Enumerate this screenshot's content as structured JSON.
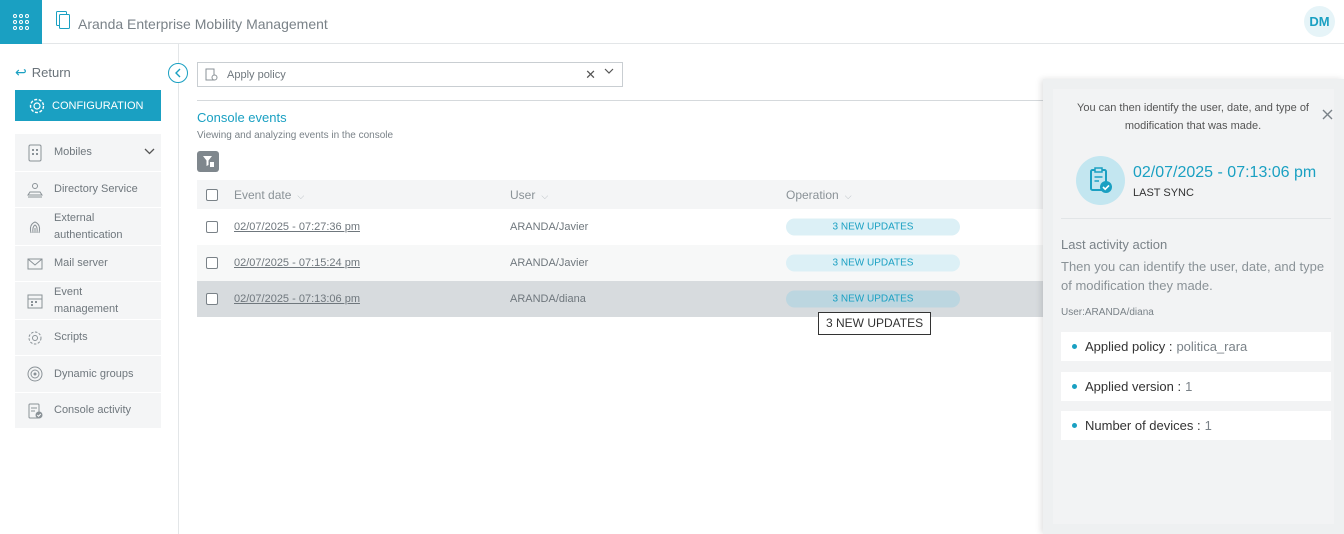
{
  "header": {
    "app_title": "Aranda Enterprise Mobility Management",
    "avatar_initials": "DM",
    "brand_color": "#1aa0c2"
  },
  "sidebar": {
    "return_label": "Return",
    "config_label": "CONFIGURATION",
    "items": [
      {
        "label": "Mobiles",
        "icon": "mobile-grid-icon",
        "expandable": true
      },
      {
        "label": "Directory Service",
        "icon": "directory-icon"
      },
      {
        "label": "External authentication",
        "icon": "fingerprint-icon"
      },
      {
        "label": "Mail server",
        "icon": "mail-icon"
      },
      {
        "label": "Event management",
        "icon": "calendar-icon"
      },
      {
        "label": "Scripts",
        "icon": "gear-icon"
      },
      {
        "label": "Dynamic groups",
        "icon": "target-icon"
      },
      {
        "label": "Console activity",
        "icon": "clipboard-check-icon"
      }
    ]
  },
  "policy_select": {
    "placeholder": "Apply policy"
  },
  "main": {
    "title": "Console events",
    "subtitle": "Viewing and analyzing events in the console"
  },
  "table": {
    "columns": [
      "Event date",
      "User",
      "Operation"
    ],
    "rows": [
      {
        "date": "02/07/2025 - 07:27:36 pm",
        "user": "ARANDA/Javier",
        "operation": "3 NEW UPDATES"
      },
      {
        "date": "02/07/2025 - 07:15:24 pm",
        "user": "ARANDA/Javier",
        "operation": "3 NEW UPDATES"
      },
      {
        "date": "02/07/2025 - 07:13:06 pm",
        "user": "ARANDA/diana",
        "operation": "3 NEW UPDATES"
      }
    ],
    "tooltip": "3 NEW UPDATES"
  },
  "panel": {
    "intro": "You can then identify the user, date, and type of modification that was made.",
    "sync_date": "02/07/2025 - 07:13:06 pm",
    "sync_label": "LAST SYNC",
    "activity_title": "Last activity action",
    "activity_desc": "Then you can identify the user, date, and type of modification they made.",
    "activity_user": "User:ARANDA/diana",
    "details": [
      {
        "label": "Applied policy :",
        "value": "politica_rara"
      },
      {
        "label": "Applied version :",
        "value": "1"
      },
      {
        "label": "Number of devices :",
        "value": "1"
      }
    ]
  }
}
